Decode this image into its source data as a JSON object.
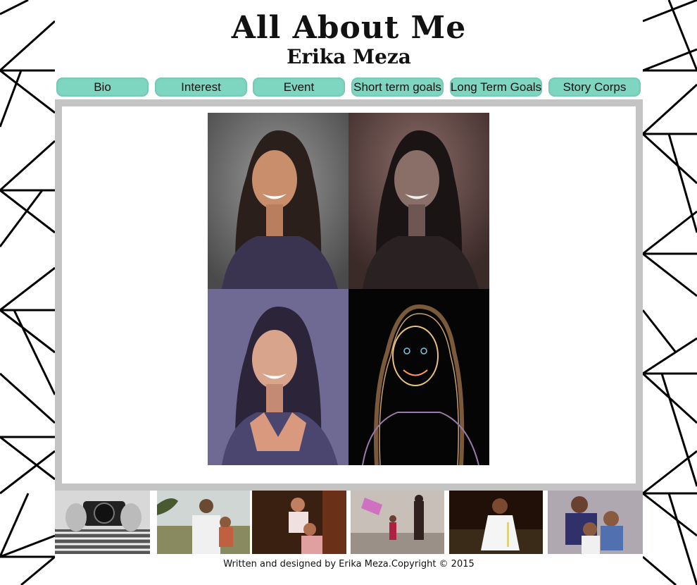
{
  "header": {
    "title": "All About Me",
    "subtitle": "Erika Meza"
  },
  "nav": {
    "items": [
      {
        "label": "Bio"
      },
      {
        "label": "Interest"
      },
      {
        "label": "Event"
      },
      {
        "label": "Short term goals"
      },
      {
        "label": "Long Term Goals"
      },
      {
        "label": "Story Corps"
      }
    ]
  },
  "main": {
    "image": "four-panel portrait of Erika Meza in different color effects"
  },
  "thumbnails": [
    {
      "icon": "photographer-with-camera"
    },
    {
      "icon": "man-holding-baby-outdoors"
    },
    {
      "icon": "children-sitting-together"
    },
    {
      "icon": "pinata-party"
    },
    {
      "icon": "baby-in-white-dress"
    },
    {
      "icon": "man-with-two-children"
    }
  ],
  "footer": {
    "text": "Written and designed by Erika Meza.Copyright © 2015"
  },
  "colors": {
    "nav_button": "#7fd6c0",
    "frame": "#c4c4c4",
    "background": "#ffffff"
  }
}
